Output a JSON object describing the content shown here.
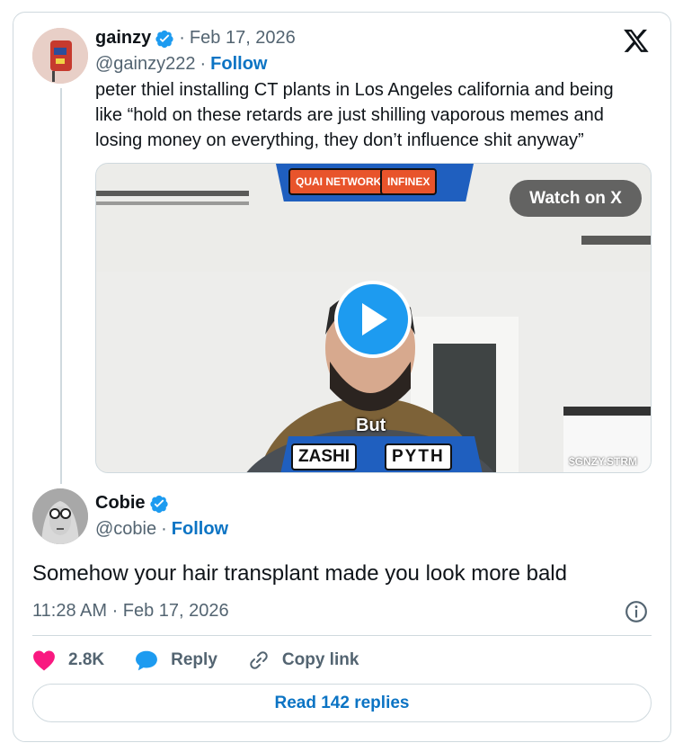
{
  "parent_tweet": {
    "display_name": "gainzy",
    "date": "Feb 17, 2026",
    "handle": "@gainzy222",
    "follow_label": "Follow",
    "text": "peter thiel installing CT plants in Los Angeles california and being like “hold on these retards are just shilling vaporous memes and losing money on everything, they don’t influence shit anyway”",
    "video": {
      "watch_label": "Watch on X",
      "caption": "But",
      "sponsors_top": [
        "QUAI NETWORK",
        "INFINEX"
      ],
      "sponsors_bottom": [
        "ZASHI",
        "PYTH"
      ],
      "watermark": "$GNZY.STRM"
    }
  },
  "reply_tweet": {
    "display_name": "Cobie",
    "handle": "@cobie",
    "follow_label": "Follow",
    "text": "Somehow your hair transplant made you look more bald",
    "timestamp": "11:28 AM · Feb 17, 2026"
  },
  "actions": {
    "likes": "2.8K",
    "reply_label": "Reply",
    "copy_label": "Copy link"
  },
  "read_replies_label": "Read 142 replies",
  "icons": [
    "x-logo-icon",
    "verified-badge-icon",
    "play-icon",
    "info-icon",
    "heart-icon",
    "reply-bubble-icon",
    "link-icon"
  ],
  "colors": {
    "accent": "#1d9bf0",
    "link": "#0c74c4",
    "heart": "#f91880",
    "muted": "#536471",
    "border": "#cfd9de"
  }
}
